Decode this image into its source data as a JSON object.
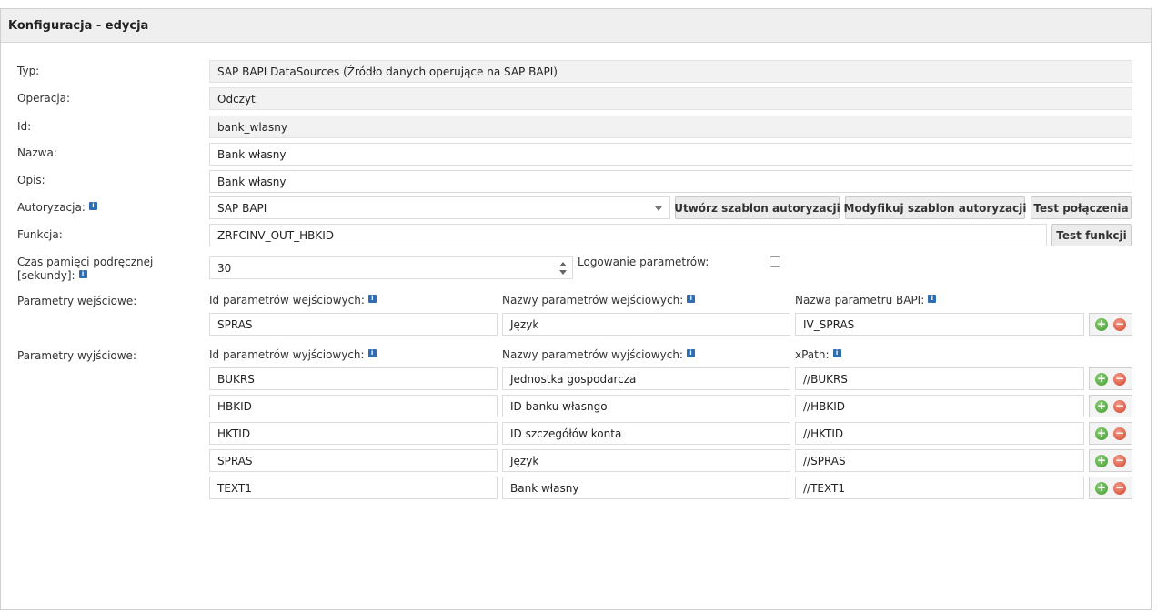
{
  "header": {
    "title": "Konfiguracja - edycja"
  },
  "labels": {
    "typ": "Typ:",
    "operacja": "Operacja:",
    "id": "Id:",
    "nazwa": "Nazwa:",
    "opis": "Opis:",
    "autoryzacja": "Autoryzacja:",
    "funkcja": "Funkcja:",
    "czas_line1": "Czas pamięci podręcznej",
    "czas_line2": "[sekundy]:",
    "logowanie": "Logowanie parametrów:",
    "param_in": "Parametry wejściowe:",
    "param_out": "Parametry wyjściowe:"
  },
  "fields": {
    "typ": "SAP BAPI DataSources (Źródło danych operujące na SAP BAPI)",
    "operacja": "Odczyt",
    "id": "bank_wlasny",
    "nazwa": "Bank własny",
    "opis": "Bank własny",
    "autoryzacja": "SAP BAPI",
    "funkcja": "ZRFCINV_OUT_HBKID",
    "czas": "30",
    "logowanie_checked": false
  },
  "buttons": {
    "utworz": "Utwórz szablon autoryzacji",
    "modyfikuj": "Modyfikuj szablon autoryzacji",
    "test_polaczenia": "Test połączenia",
    "test_funkcji": "Test funkcji"
  },
  "input_params": {
    "headers": [
      "Id parametrów wejściowych:",
      "Nazwy parametrów wejściowych:",
      "Nazwa parametru BAPI:"
    ],
    "rows": [
      [
        "SPRAS",
        "Język",
        "IV_SPRAS"
      ]
    ]
  },
  "output_params": {
    "headers": [
      "Id parametrów wyjściowych:",
      "Nazwy parametrów wyjściowych:",
      "xPath:"
    ],
    "rows": [
      [
        "BUKRS",
        "Jednostka gospodarcza",
        "//BUKRS"
      ],
      [
        "HBKID",
        "ID banku własngo",
        "//HBKID"
      ],
      [
        "HKTID",
        "ID szczegółów konta",
        "//HKTID"
      ],
      [
        "SPRAS",
        "Język",
        "//SPRAS"
      ],
      [
        "TEXT1",
        "Bank własny",
        "//TEXT1"
      ]
    ]
  },
  "icons": {
    "info": "info-icon",
    "add": "add-row-icon",
    "remove": "remove-row-icon"
  },
  "colors": {
    "info_icon": "#2f6db0",
    "add": "#3f9a2c",
    "remove": "#d2452e"
  }
}
